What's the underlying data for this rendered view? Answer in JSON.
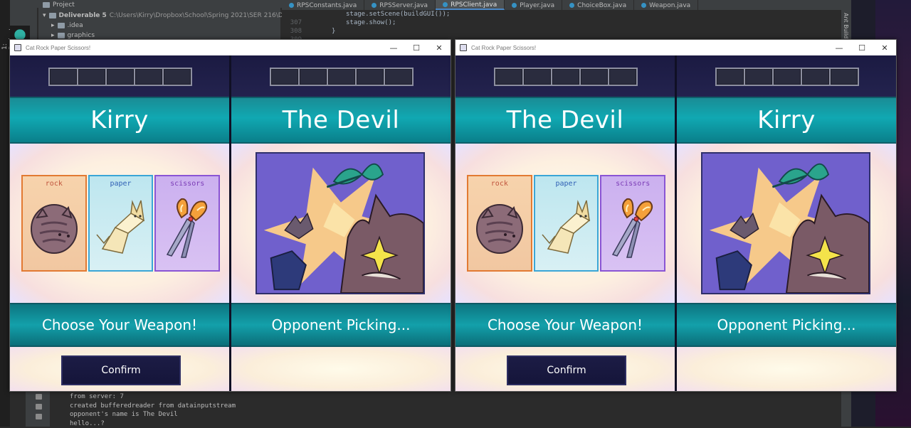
{
  "ide": {
    "sidebar_label": "1: Project",
    "project_menu": "Project",
    "tree": {
      "root_name": "Deliverable 5",
      "root_path": "C:\\Users\\Kirry\\Dropbox\\School\\Spring 2021\\SER 216\\Deliverable 5",
      "items": [
        ".idea",
        "graphics"
      ]
    },
    "editor_tabs": [
      {
        "label": "RPSConstants.java",
        "active": false
      },
      {
        "label": "RPSServer.java",
        "active": false
      },
      {
        "label": "RPSClient.java",
        "active": true
      },
      {
        "label": "Player.java",
        "active": false
      },
      {
        "label": "ChoiceBox.java",
        "active": false
      },
      {
        "label": "Weapon.java",
        "active": false
      }
    ],
    "code_lines": [
      {
        "num": "",
        "text": "stage.setScene(buildGUI());"
      },
      {
        "num": "307",
        "text": "stage.show();"
      },
      {
        "num": "308",
        "text": "}"
      },
      {
        "num": "309",
        "text": ""
      }
    ],
    "right_panel_label": "Ant Build",
    "console_lines": [
      "from server: 7",
      "created bufferedreader from datainputstream",
      "opponent's name is The Devil",
      "hello...?"
    ]
  },
  "windows": [
    {
      "title": "Cat Rock Paper Scissors!",
      "controls": {
        "minimize": "—",
        "maximize": "☐",
        "close": "✕"
      },
      "left": {
        "player_name": "Kirry",
        "cards": [
          {
            "type": "rock",
            "label": "rock"
          },
          {
            "type": "paper",
            "label": "paper"
          },
          {
            "type": "scissors",
            "label": "scissors"
          }
        ],
        "status": "Choose Your Weapon!",
        "button": "Confirm"
      },
      "right": {
        "player_name": "The Devil",
        "status": "Opponent Picking..."
      }
    },
    {
      "title": "Cat Rock Paper Scissors!",
      "controls": {
        "minimize": "—",
        "maximize": "☐",
        "close": "✕"
      },
      "left": {
        "player_name": "The Devil",
        "cards": [
          {
            "type": "rock",
            "label": "rock"
          },
          {
            "type": "paper",
            "label": "paper"
          },
          {
            "type": "scissors",
            "label": "scissors"
          }
        ],
        "status": "Choose Your Weapon!",
        "button": "Confirm"
      },
      "right": {
        "player_name": "Kirry",
        "status": "Opponent Picking..."
      }
    }
  ],
  "colors": {
    "teal_band": "#10a8b2",
    "navy": "#17173a",
    "rock_border": "#e27a32",
    "paper_border": "#3aa6d6",
    "scissors_border": "#8a55d4"
  }
}
